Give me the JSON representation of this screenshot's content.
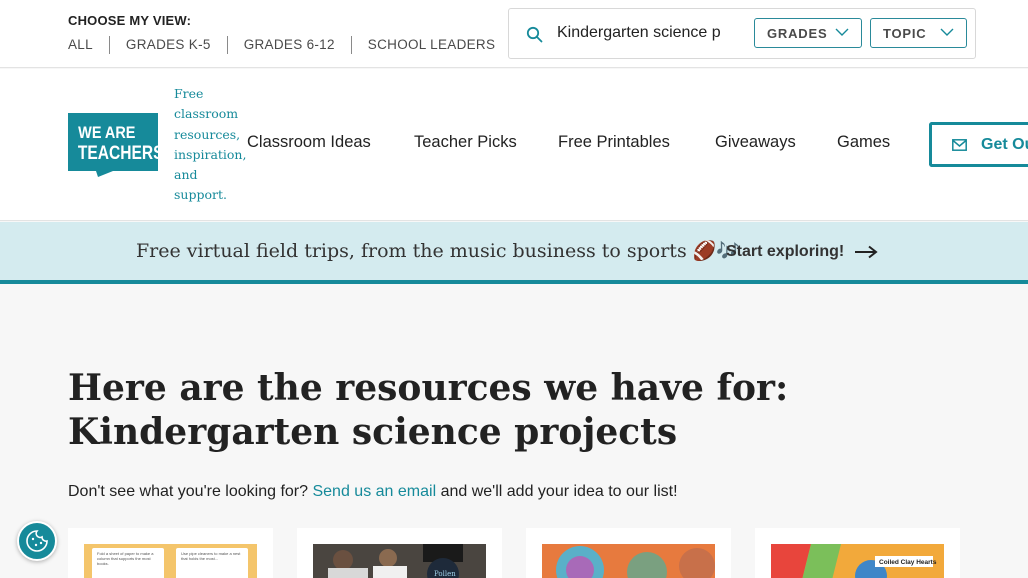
{
  "view_selector": {
    "label": "CHOOSE MY VIEW:",
    "links": [
      "ALL",
      "GRADES K-5",
      "GRADES 6-12",
      "SCHOOL LEADERS"
    ]
  },
  "search": {
    "value": "Kindergarten science p",
    "grades_label": "GRADES",
    "topic_label": "TOPIC"
  },
  "brand": {
    "logo_line1": "WE ARE",
    "logo_line2": "TEACHERS",
    "tagline": "Free classroom resources, inspiration, and support.",
    "color": "#168a9a"
  },
  "nav": {
    "items": [
      "Classroom Ideas",
      "Teacher Picks",
      "Free Printables",
      "Giveaways",
      "Games"
    ],
    "cta_label": "Get Our"
  },
  "banner": {
    "text": "Free virtual field trips, from the music business to sports",
    "emoji": "🏈🎶",
    "link": "Start exploring!"
  },
  "main": {
    "title": "Here are the resources we have for: Kindergarten science projects",
    "sub_prefix": "Don't see what you're looking for?",
    "sub_link": "Send us an email",
    "sub_suffix": "and we'll add your idea to our list!"
  },
  "cards": {
    "card1_paper1": "Fold a sheet of paper to make a column that supports the most books.",
    "card1_paper2": "Use pipe cleaners to make a nest that holds the most...",
    "card2_sign": "Pollen",
    "card4_label": "Coiled Clay Hearts"
  },
  "icons": {
    "search": "search-icon",
    "chevron": "chevron-down-icon",
    "mail": "mail-icon",
    "arrow": "arrow-right-icon",
    "cookie": "cookie-icon"
  }
}
